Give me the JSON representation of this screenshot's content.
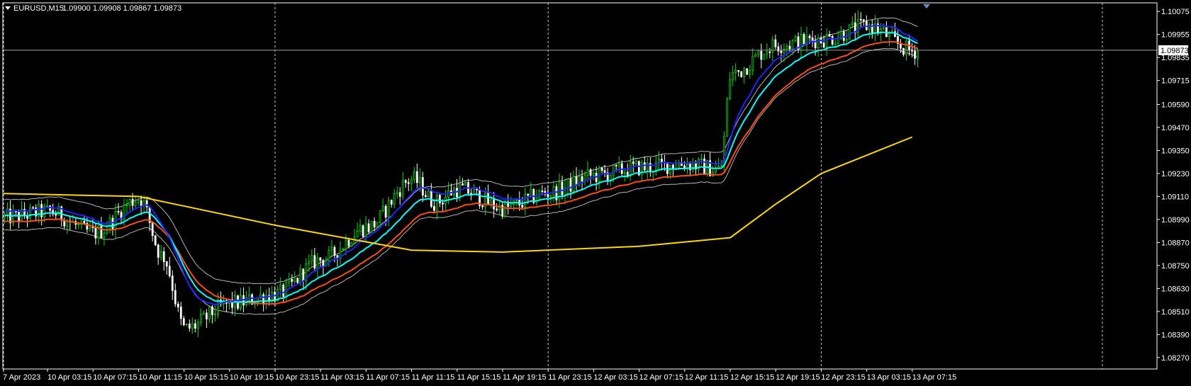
{
  "header": {
    "symbol": "EURUSD,M15",
    "ohlc": "1.09900 1.09908 1.09867 1.09873"
  },
  "current_price": "1.09873",
  "colors": {
    "background": "#000000",
    "grid": "#c8c8c8",
    "bull_candle": "#00e000",
    "bear_candle": "#ffffff",
    "ma_slow": "#ffd700",
    "ma_blue": "#1e24ff",
    "ma_cyan": "#00ffff",
    "ma_red": "#ff4a10",
    "envelope": "#b4b4b4",
    "price_line": "#a0a0a0"
  },
  "chart_data": {
    "type": "line",
    "instrument": "EURUSD",
    "timeframe": "M15",
    "ylim": [
      1.0821,
      1.1012
    ],
    "y_ticks": [
      "1.10075",
      "1.09955",
      "1.09835",
      "1.09715",
      "1.09590",
      "1.09470",
      "1.09350",
      "1.09230",
      "1.09110",
      "1.08990",
      "1.08870",
      "1.08750",
      "1.08630",
      "1.08510",
      "1.08390",
      "1.08270"
    ],
    "x_ticks": [
      "7 Apr 2023",
      "10 Apr 03:15",
      "10 Apr 07:15",
      "10 Apr 11:15",
      "10 Apr 15:15",
      "10 Apr 19:15",
      "10 Apr 23:15",
      "11 Apr 03:15",
      "11 Apr 07:15",
      "11 Apr 11:15",
      "11 Apr 15:15",
      "11 Apr 19:15",
      "11 Apr 23:15",
      "12 Apr 03:15",
      "12 Apr 07:15",
      "12 Apr 11:15",
      "12 Apr 15:15",
      "12 Apr 19:15",
      "12 Apr 23:15",
      "13 Apr 03:15",
      "13 Apr 07:15"
    ],
    "period_separators": [
      "7 Apr 2023",
      "10 Apr 23:15",
      "11 Apr 23:15",
      "12 Apr 23:15",
      "13 Apr 23:15"
    ],
    "price_anchors": [
      [
        "7 Apr 2023",
        1.09
      ],
      [
        "10 Apr 03:15",
        1.0903
      ],
      [
        "10 Apr 07:15",
        1.0892
      ],
      [
        "10 Apr 11:15",
        1.091
      ],
      [
        "10 Apr 13:15",
        1.088
      ],
      [
        "10 Apr 15:15",
        1.0842
      ],
      [
        "10 Apr 19:15",
        1.0855
      ],
      [
        "10 Apr 23:15",
        1.086
      ],
      [
        "11 Apr 03:15",
        1.0878
      ],
      [
        "11 Apr 07:15",
        1.0895
      ],
      [
        "11 Apr 11:15",
        1.092
      ],
      [
        "11 Apr 13:15",
        1.0908
      ],
      [
        "11 Apr 15:15",
        1.0915
      ],
      [
        "11 Apr 19:15",
        1.0905
      ],
      [
        "11 Apr 23:15",
        1.0913
      ],
      [
        "12 Apr 03:15",
        1.0922
      ],
      [
        "12 Apr 07:15",
        1.0926
      ],
      [
        "12 Apr 11:15",
        1.0928
      ],
      [
        "12 Apr 14:15",
        1.0925
      ],
      [
        "12 Apr 15:15",
        1.0975
      ],
      [
        "12 Apr 19:15",
        1.099
      ],
      [
        "12 Apr 23:15",
        1.0993
      ],
      [
        "13 Apr 03:15",
        1.1
      ],
      [
        "13 Apr 07:15",
        1.0987
      ]
    ],
    "slow_ma": [
      [
        "7 Apr 2023",
        1.09125
      ],
      [
        "10 Apr 11:15",
        1.0911
      ],
      [
        "10 Apr 23:15",
        1.0896
      ],
      [
        "11 Apr 11:15",
        1.0883
      ],
      [
        "11 Apr 19:15",
        1.0882
      ],
      [
        "12 Apr 07:15",
        1.0885
      ],
      [
        "12 Apr 15:15",
        1.08895
      ],
      [
        "12 Apr 19:15",
        1.0907
      ],
      [
        "12 Apr 23:15",
        1.0923
      ],
      [
        "13 Apr 07:15",
        1.0942
      ]
    ]
  }
}
